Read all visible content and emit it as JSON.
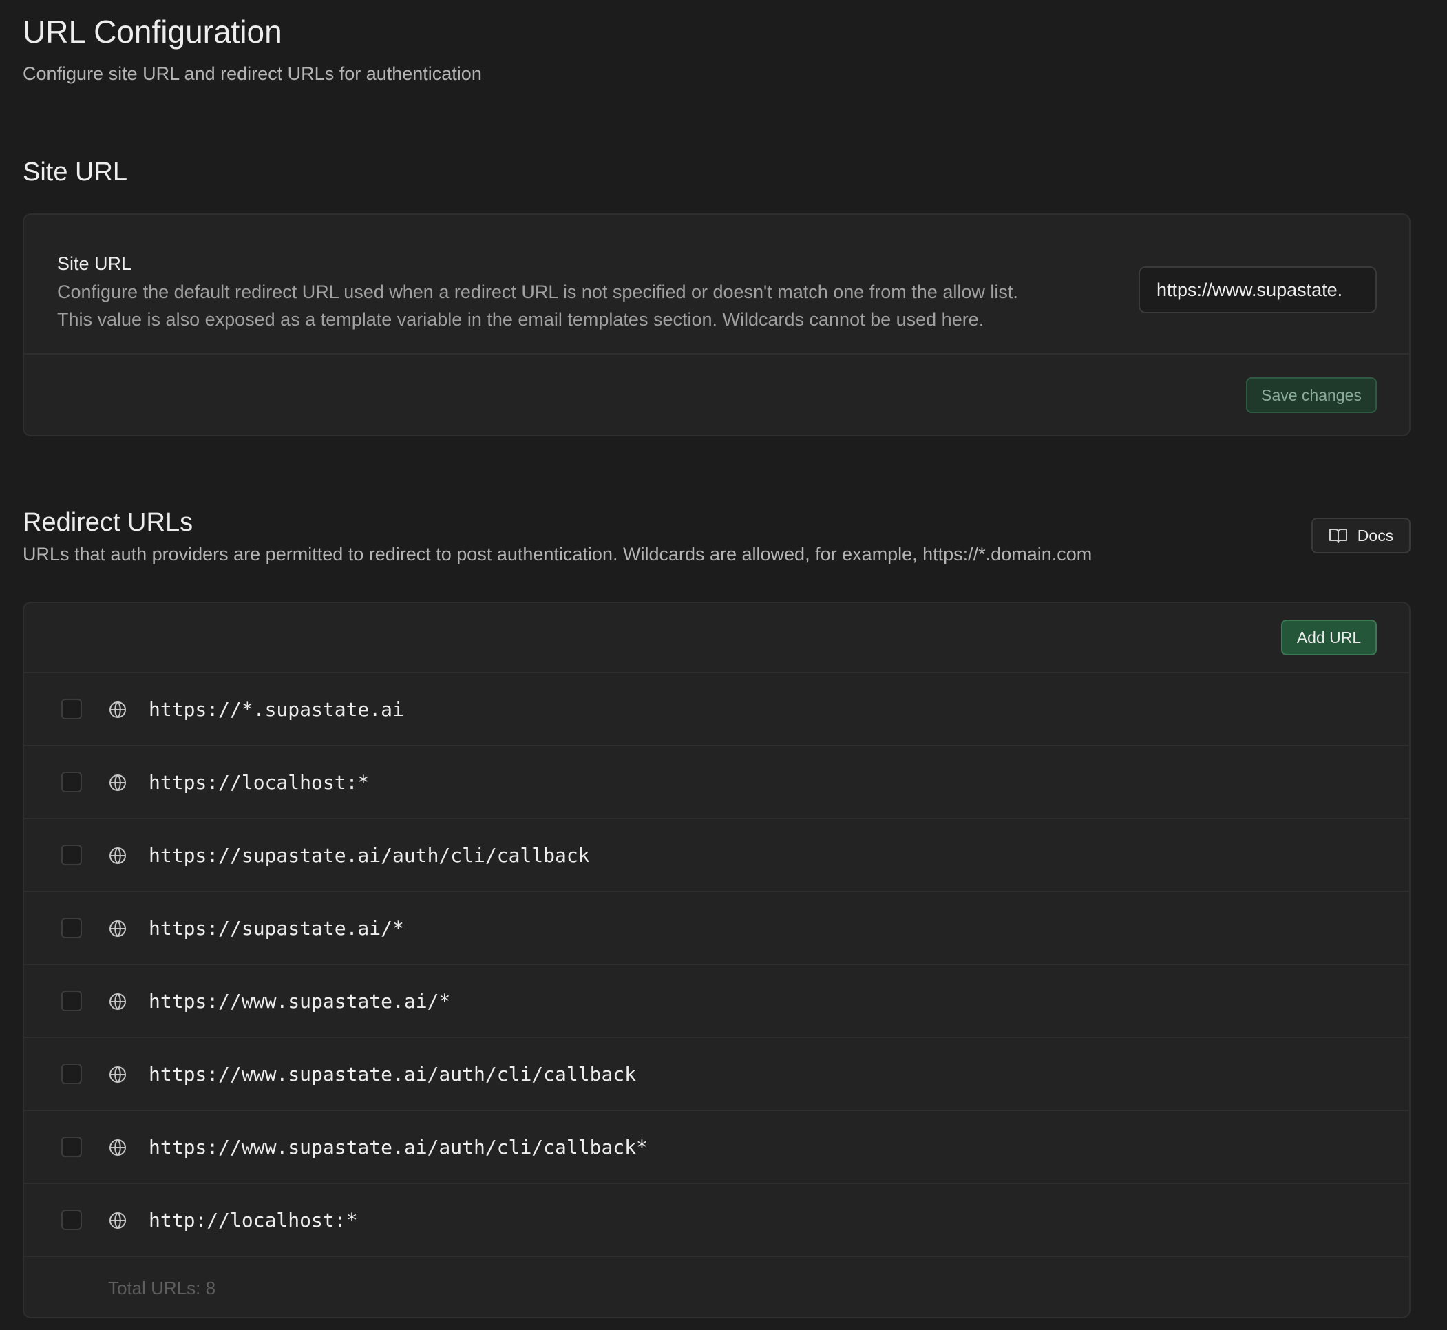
{
  "page": {
    "title": "URL Configuration",
    "subtitle": "Configure site URL and redirect URLs for authentication"
  },
  "site_url": {
    "section_title": "Site URL",
    "field_label": "Site URL",
    "description_line1": "Configure the default redirect URL used when a redirect URL is not specified or doesn't match one from the allow list.",
    "description_line2": "This value is also exposed as a template variable in the email templates section. Wildcards cannot be used here.",
    "input_value": "https://www.supastate.",
    "save_label": "Save changes"
  },
  "redirect_urls": {
    "section_title": "Redirect URLs",
    "description": "URLs that auth providers are permitted to redirect to post authentication. Wildcards are allowed, for example, https://*.domain.com",
    "docs_label": "Docs",
    "add_label": "Add URL",
    "urls": [
      "https://*.supastate.ai",
      "https://localhost:*",
      "https://supastate.ai/auth/cli/callback",
      "https://supastate.ai/*",
      "https://www.supastate.ai/*",
      "https://www.supastate.ai/auth/cli/callback",
      "https://www.supastate.ai/auth/cli/callback*",
      "http://localhost:*"
    ],
    "total_label": "Total URLs: 8"
  },
  "icons": {
    "docs": "book-open-icon",
    "url_row": "globe-icon"
  },
  "colors": {
    "background": "#1c1c1c",
    "card": "#232323",
    "accent_green": "#24563a"
  }
}
